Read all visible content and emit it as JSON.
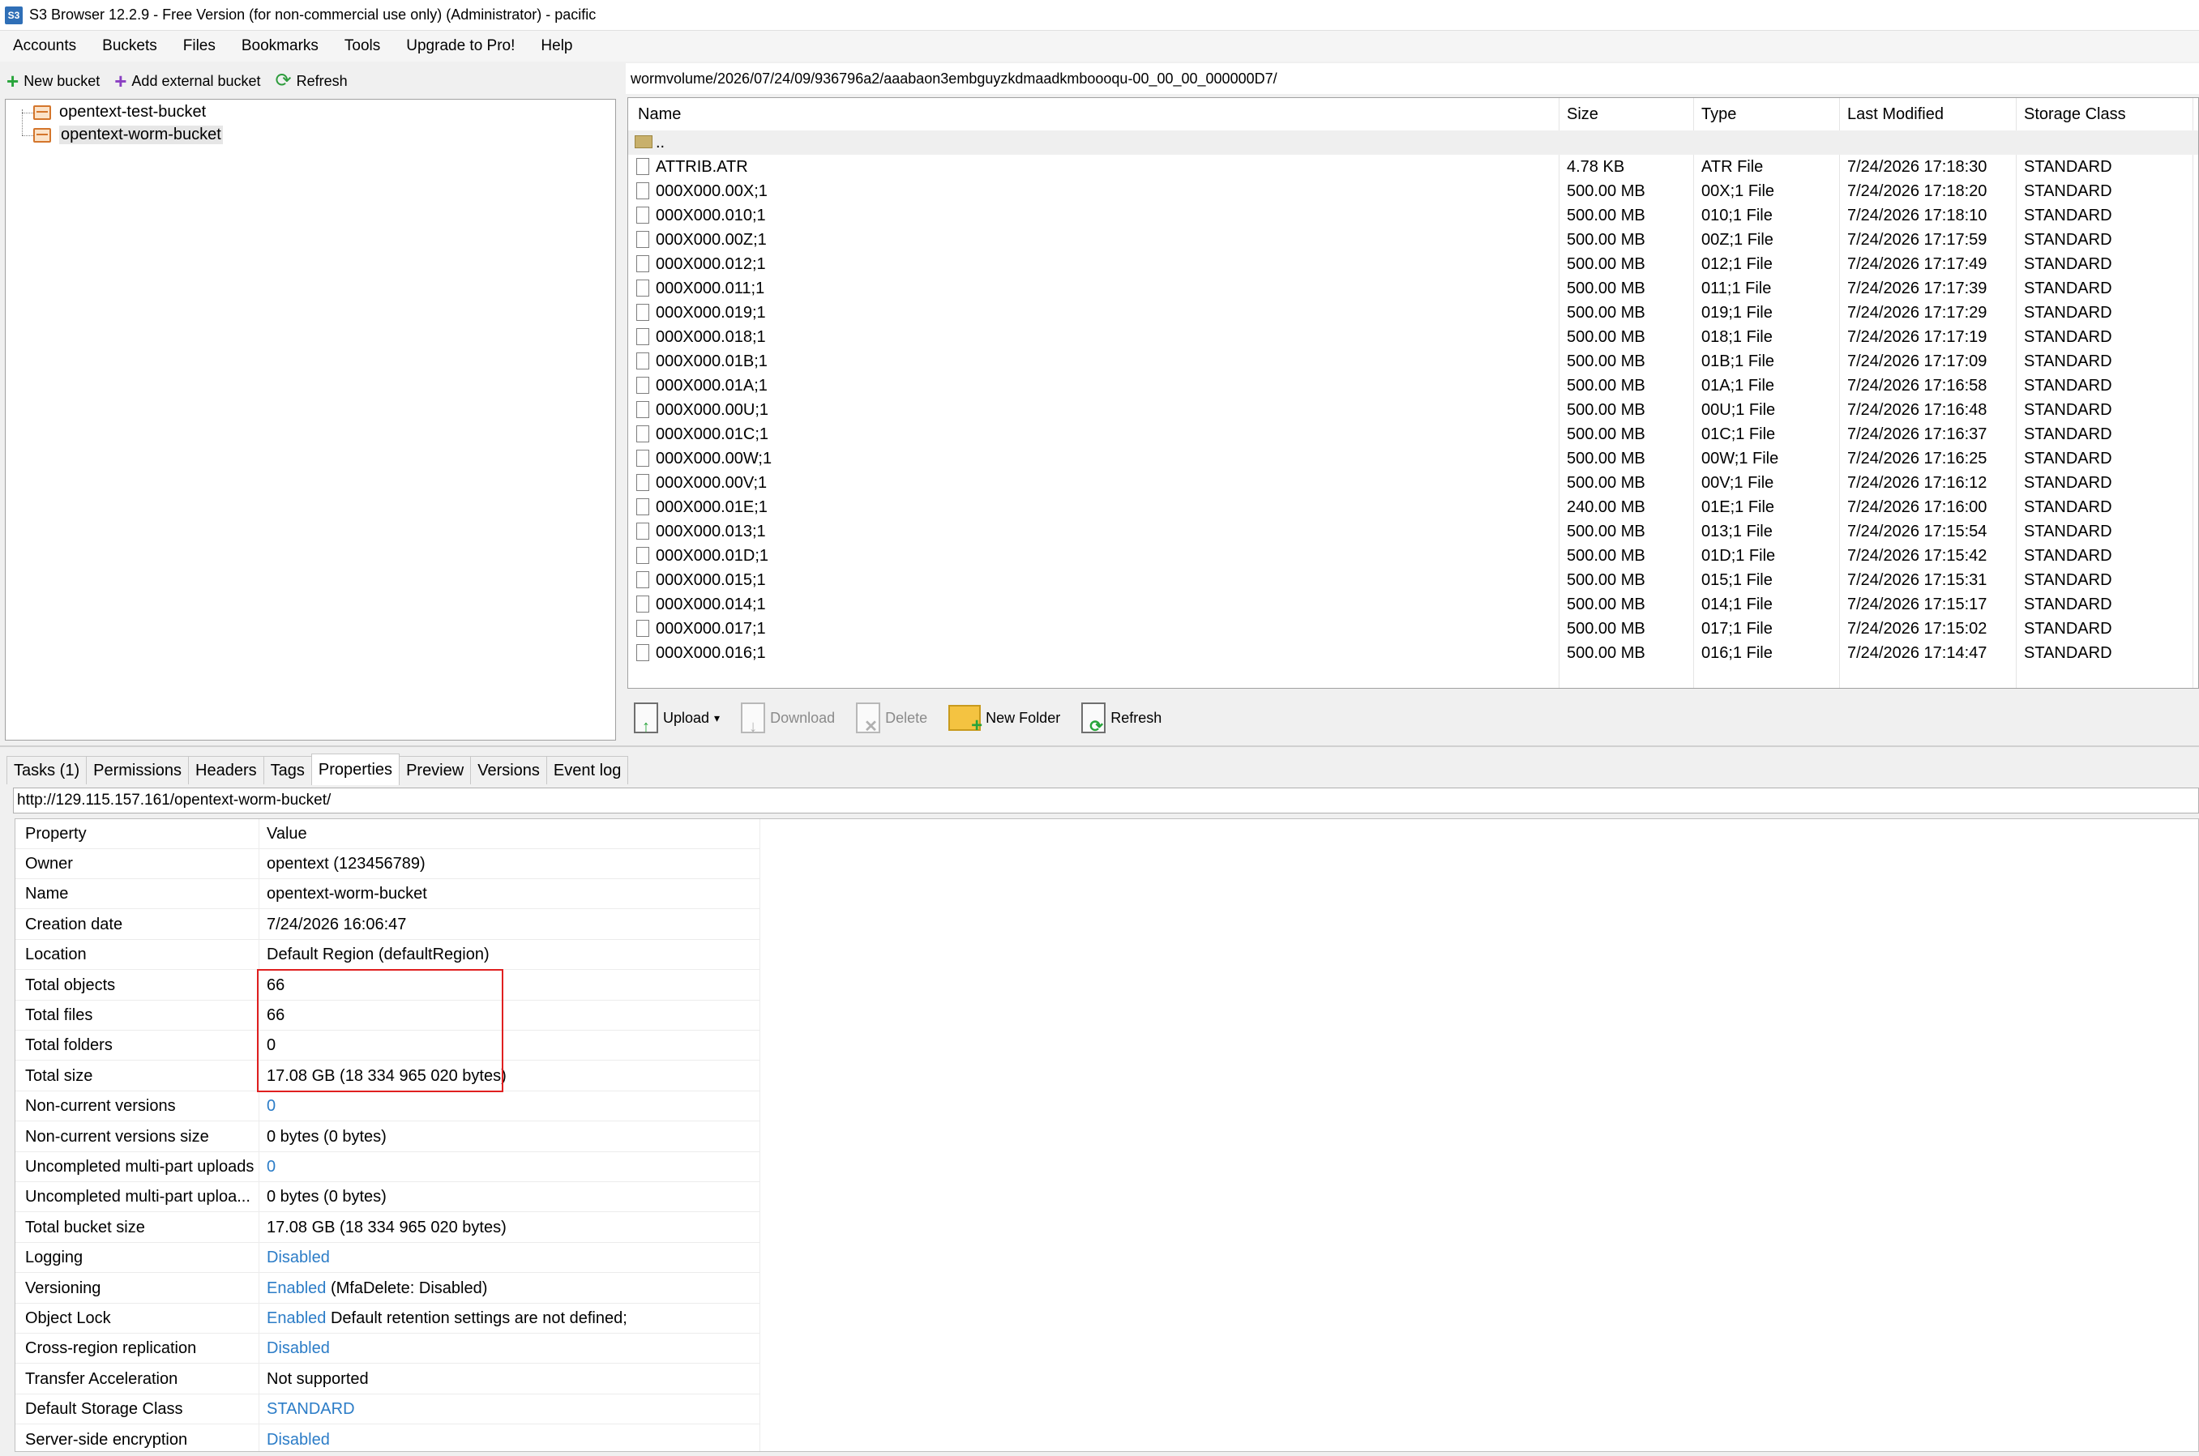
{
  "window": {
    "icon_text": "S3",
    "title": "S3 Browser 12.2.9 - Free Version (for non-commercial use only) (Administrator) - pacific"
  },
  "menu": [
    "Accounts",
    "Buckets",
    "Files",
    "Bookmarks",
    "Tools",
    "Upgrade to Pro!",
    "Help"
  ],
  "left_toolbar": {
    "new_bucket": "New bucket",
    "add_external_bucket": "Add external bucket",
    "refresh": "Refresh"
  },
  "buckets": [
    {
      "name": "opentext-test-bucket"
    },
    {
      "name": "opentext-worm-bucket"
    }
  ],
  "path": "wormvolume/2026/07/24/09/936796a2/aaabaon3embguyzkdmaadkmboooqu-00_00_00_000000D7/",
  "file_columns": [
    "Name",
    "Size",
    "Type",
    "Last Modified",
    "Storage Class"
  ],
  "parent_row": "..",
  "files": [
    {
      "name": "ATTRIB.ATR",
      "size": "4.78 KB",
      "type": "ATR File",
      "modified": "7/24/2026 17:18:30",
      "class": "STANDARD"
    },
    {
      "name": "000X000.00X;1",
      "size": "500.00 MB",
      "type": "00X;1 File",
      "modified": "7/24/2026 17:18:20",
      "class": "STANDARD"
    },
    {
      "name": "000X000.010;1",
      "size": "500.00 MB",
      "type": "010;1 File",
      "modified": "7/24/2026 17:18:10",
      "class": "STANDARD"
    },
    {
      "name": "000X000.00Z;1",
      "size": "500.00 MB",
      "type": "00Z;1 File",
      "modified": "7/24/2026 17:17:59",
      "class": "STANDARD"
    },
    {
      "name": "000X000.012;1",
      "size": "500.00 MB",
      "type": "012;1 File",
      "modified": "7/24/2026 17:17:49",
      "class": "STANDARD"
    },
    {
      "name": "000X000.011;1",
      "size": "500.00 MB",
      "type": "011;1 File",
      "modified": "7/24/2026 17:17:39",
      "class": "STANDARD"
    },
    {
      "name": "000X000.019;1",
      "size": "500.00 MB",
      "type": "019;1 File",
      "modified": "7/24/2026 17:17:29",
      "class": "STANDARD"
    },
    {
      "name": "000X000.018;1",
      "size": "500.00 MB",
      "type": "018;1 File",
      "modified": "7/24/2026 17:17:19",
      "class": "STANDARD"
    },
    {
      "name": "000X000.01B;1",
      "size": "500.00 MB",
      "type": "01B;1 File",
      "modified": "7/24/2026 17:17:09",
      "class": "STANDARD"
    },
    {
      "name": "000X000.01A;1",
      "size": "500.00 MB",
      "type": "01A;1 File",
      "modified": "7/24/2026 17:16:58",
      "class": "STANDARD"
    },
    {
      "name": "000X000.00U;1",
      "size": "500.00 MB",
      "type": "00U;1 File",
      "modified": "7/24/2026 17:16:48",
      "class": "STANDARD"
    },
    {
      "name": "000X000.01C;1",
      "size": "500.00 MB",
      "type": "01C;1 File",
      "modified": "7/24/2026 17:16:37",
      "class": "STANDARD"
    },
    {
      "name": "000X000.00W;1",
      "size": "500.00 MB",
      "type": "00W;1 File",
      "modified": "7/24/2026 17:16:25",
      "class": "STANDARD"
    },
    {
      "name": "000X000.00V;1",
      "size": "500.00 MB",
      "type": "00V;1 File",
      "modified": "7/24/2026 17:16:12",
      "class": "STANDARD"
    },
    {
      "name": "000X000.01E;1",
      "size": "240.00 MB",
      "type": "01E;1 File",
      "modified": "7/24/2026 17:16:00",
      "class": "STANDARD"
    },
    {
      "name": "000X000.013;1",
      "size": "500.00 MB",
      "type": "013;1 File",
      "modified": "7/24/2026 17:15:54",
      "class": "STANDARD"
    },
    {
      "name": "000X000.01D;1",
      "size": "500.00 MB",
      "type": "01D;1 File",
      "modified": "7/24/2026 17:15:42",
      "class": "STANDARD"
    },
    {
      "name": "000X000.015;1",
      "size": "500.00 MB",
      "type": "015;1 File",
      "modified": "7/24/2026 17:15:31",
      "class": "STANDARD"
    },
    {
      "name": "000X000.014;1",
      "size": "500.00 MB",
      "type": "014;1 File",
      "modified": "7/24/2026 17:15:17",
      "class": "STANDARD"
    },
    {
      "name": "000X000.017;1",
      "size": "500.00 MB",
      "type": "017;1 File",
      "modified": "7/24/2026 17:15:02",
      "class": "STANDARD"
    },
    {
      "name": "000X000.016;1",
      "size": "500.00 MB",
      "type": "016;1 File",
      "modified": "7/24/2026 17:14:47",
      "class": "STANDARD"
    }
  ],
  "file_toolbar": {
    "upload": "Upload",
    "upload_arrow": "▾",
    "download": "Download",
    "delete": "Delete",
    "new_folder": "New Folder",
    "refresh": "Refresh"
  },
  "tabs": [
    "Tasks (1)",
    "Permissions",
    "Headers",
    "Tags",
    "Properties",
    "Preview",
    "Versions",
    "Event log"
  ],
  "active_tab": "Properties",
  "url": "http://129.115.157.161/opentext-worm-bucket/",
  "properties_header": {
    "name": "Property",
    "value": "Value"
  },
  "properties": [
    {
      "name": "Owner",
      "value": "opentext (123456789)"
    },
    {
      "name": "Name",
      "value": "opentext-worm-bucket"
    },
    {
      "name": "Creation date",
      "value": "7/24/2026 16:06:47"
    },
    {
      "name": "Location",
      "value": "Default Region (defaultRegion)"
    },
    {
      "name": "Total objects",
      "value": "66"
    },
    {
      "name": "Total files",
      "value": "66"
    },
    {
      "name": "Total folders",
      "value": "0"
    },
    {
      "name": "Total size",
      "value": "17.08 GB (18 334 965 020 bytes)"
    },
    {
      "name": "Non-current versions",
      "link": "0"
    },
    {
      "name": "Non-current versions size",
      "value": "0 bytes (0 bytes)"
    },
    {
      "name": "Uncompleted multi-part uploads",
      "link": "0"
    },
    {
      "name": "Uncompleted multi-part uploa...",
      "value": "0 bytes (0 bytes)"
    },
    {
      "name": "Total bucket size",
      "value": "17.08 GB (18 334 965 020 bytes)"
    },
    {
      "name": "Logging",
      "link": "Disabled"
    },
    {
      "name": "Versioning",
      "link": "Enabled",
      "value": " (MfaDelete: Disabled)"
    },
    {
      "name": "Object Lock",
      "link": "Enabled",
      "value": " Default retention settings are not defined;"
    },
    {
      "name": "Cross-region replication",
      "link": "Disabled"
    },
    {
      "name": "Transfer Acceleration",
      "value": "Not supported"
    },
    {
      "name": "Default Storage Class",
      "link": "STANDARD"
    },
    {
      "name": "Server-side encryption",
      "link": "Disabled"
    }
  ],
  "colors": {
    "link": "#2b7cc7",
    "highlight": "#e02020"
  }
}
